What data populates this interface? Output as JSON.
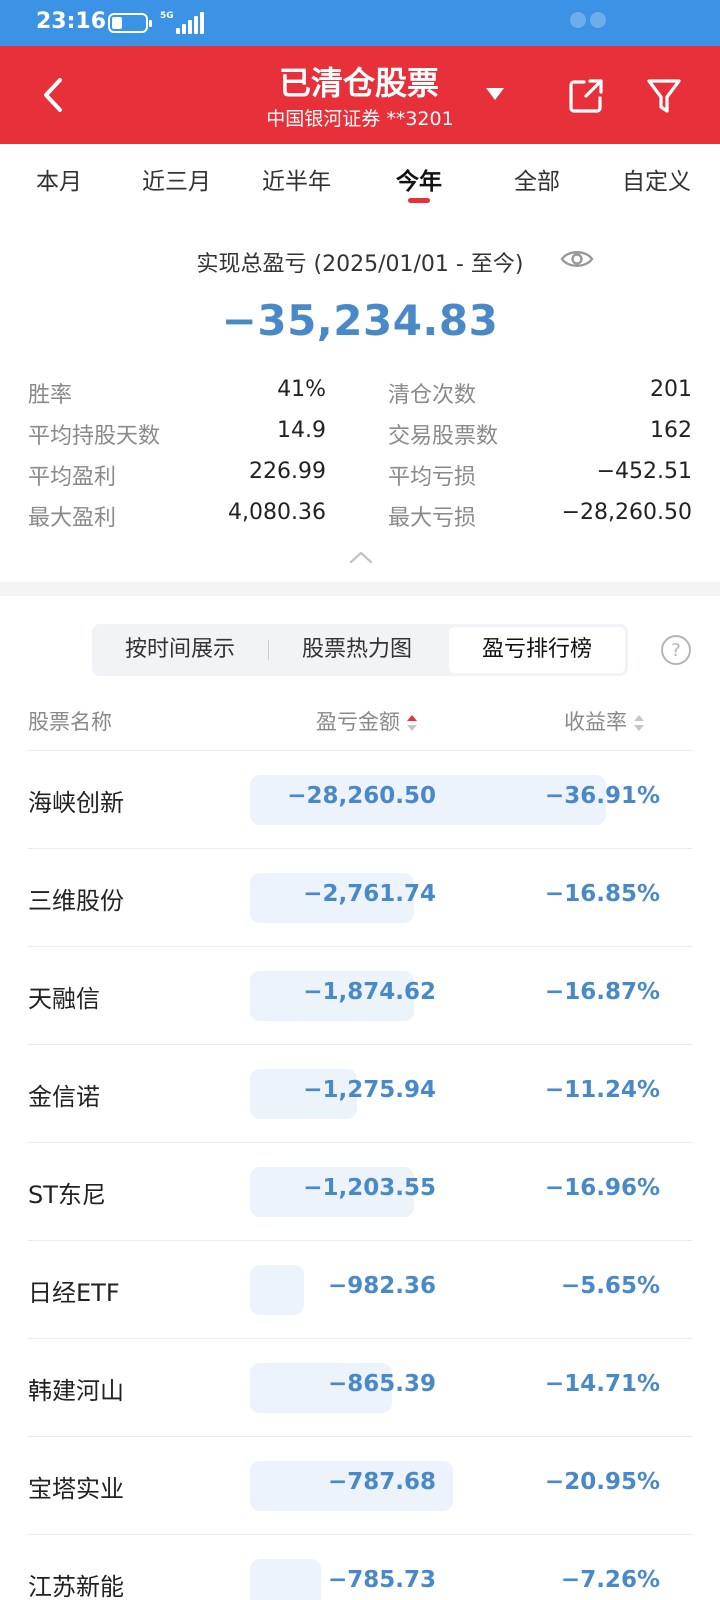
{
  "status_bar": {
    "time": "23:16",
    "network": "5G"
  },
  "header": {
    "title": "已清仓股票",
    "subtitle": "中国银河证券 **3201"
  },
  "period_tabs": [
    "本月",
    "近三月",
    "近半年",
    "今年",
    "全部",
    "自定义"
  ],
  "active_period": "今年",
  "summary": {
    "label": "实现总盈亏 (2025/01/01 - 至今)",
    "total": "−35,234.83"
  },
  "stats": {
    "win_rate_label": "胜率",
    "win_rate": "41%",
    "clear_count_label": "清仓次数",
    "clear_count": "201",
    "avg_days_label": "平均持股天数",
    "avg_days": "14.9",
    "traded_count_label": "交易股票数",
    "traded_count": "162",
    "avg_profit_label": "平均盈利",
    "avg_profit": "226.99",
    "avg_loss_label": "平均亏损",
    "avg_loss": "−452.51",
    "max_profit_label": "最大盈利",
    "max_profit": "4,080.36",
    "max_loss_label": "最大亏损",
    "max_loss": "−28,260.50"
  },
  "view_tabs": [
    "按时间展示",
    "股票热力图",
    "盈亏排行榜"
  ],
  "active_view": "盈亏排行榜",
  "table": {
    "headers": {
      "name": "股票名称",
      "amount": "盈亏金额",
      "rate": "收益率"
    },
    "rows": [
      {
        "name": "海峡创新",
        "amount": "−28,260.50",
        "rate": "−36.91%",
        "bar_fraction": 1.0
      },
      {
        "name": "三维股份",
        "amount": "−2,761.74",
        "rate": "−16.85%",
        "bar_fraction": 0.46
      },
      {
        "name": "天融信",
        "amount": "−1,874.62",
        "rate": "−16.87%",
        "bar_fraction": 0.46
      },
      {
        "name": "金信诺",
        "amount": "−1,275.94",
        "rate": "−11.24%",
        "bar_fraction": 0.3
      },
      {
        "name": "ST东尼",
        "amount": "−1,203.55",
        "rate": "−16.96%",
        "bar_fraction": 0.46
      },
      {
        "name": "日经ETF",
        "amount": "−982.36",
        "rate": "−5.65%",
        "bar_fraction": 0.15
      },
      {
        "name": "韩建河山",
        "amount": "−865.39",
        "rate": "−14.71%",
        "bar_fraction": 0.4
      },
      {
        "name": "宝塔实业",
        "amount": "−787.68",
        "rate": "−20.95%",
        "bar_fraction": 0.57
      },
      {
        "name": "江苏新能",
        "amount": "−785.73",
        "rate": "−7.26%",
        "bar_fraction": 0.2
      }
    ]
  },
  "colors": {
    "header_red": "#e8303a",
    "status_blue": "#3c92e4",
    "loss_blue": "#4a89c8",
    "bar_bg": "#edf3fa"
  }
}
